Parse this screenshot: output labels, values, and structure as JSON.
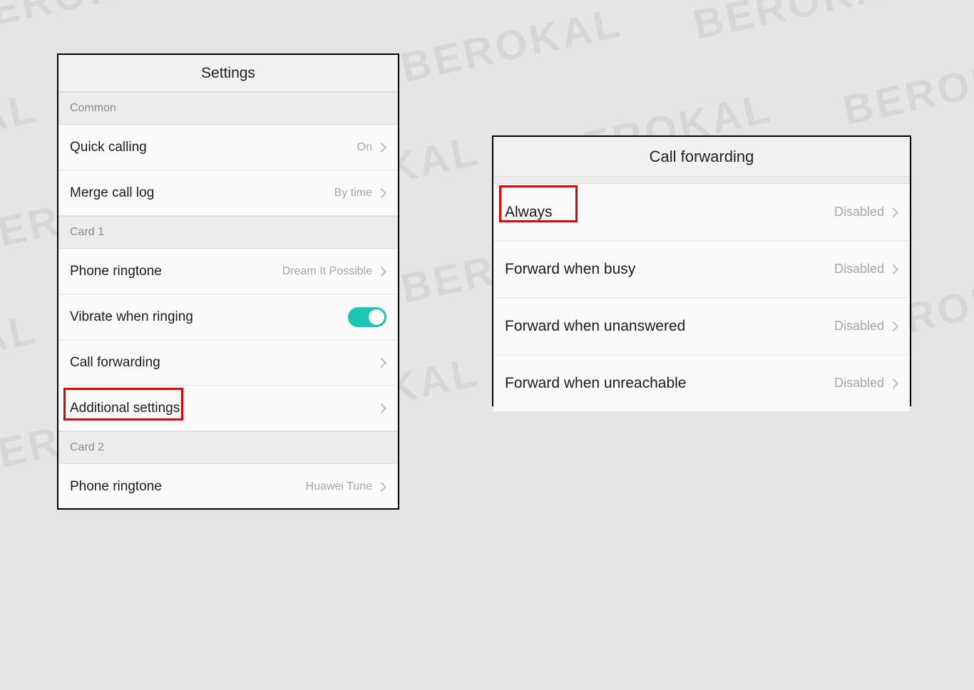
{
  "watermark": "BEROKAL",
  "left": {
    "title": "Settings",
    "sections": {
      "common": "Common",
      "card1": "Card 1",
      "card2": "Card 2"
    },
    "rows": {
      "quick_calling": {
        "label": "Quick calling",
        "value": "On"
      },
      "merge_call_log": {
        "label": "Merge call log",
        "value": "By time"
      },
      "phone_ringtone1": {
        "label": "Phone ringtone",
        "value": "Dream It Possible"
      },
      "vibrate": {
        "label": "Vibrate when ringing"
      },
      "call_forwarding": {
        "label": "Call forwarding"
      },
      "additional": {
        "label": "Additional settings"
      },
      "phone_ringtone2": {
        "label": "Phone ringtone",
        "value": "Huawei Tune"
      }
    }
  },
  "right": {
    "title": "Call forwarding",
    "rows": {
      "always": {
        "label": "Always",
        "value": "Disabled"
      },
      "busy": {
        "label": "Forward when busy",
        "value": "Disabled"
      },
      "unanswered": {
        "label": "Forward when unanswered",
        "value": "Disabled"
      },
      "unreachable": {
        "label": "Forward when unreachable",
        "value": "Disabled"
      }
    }
  }
}
